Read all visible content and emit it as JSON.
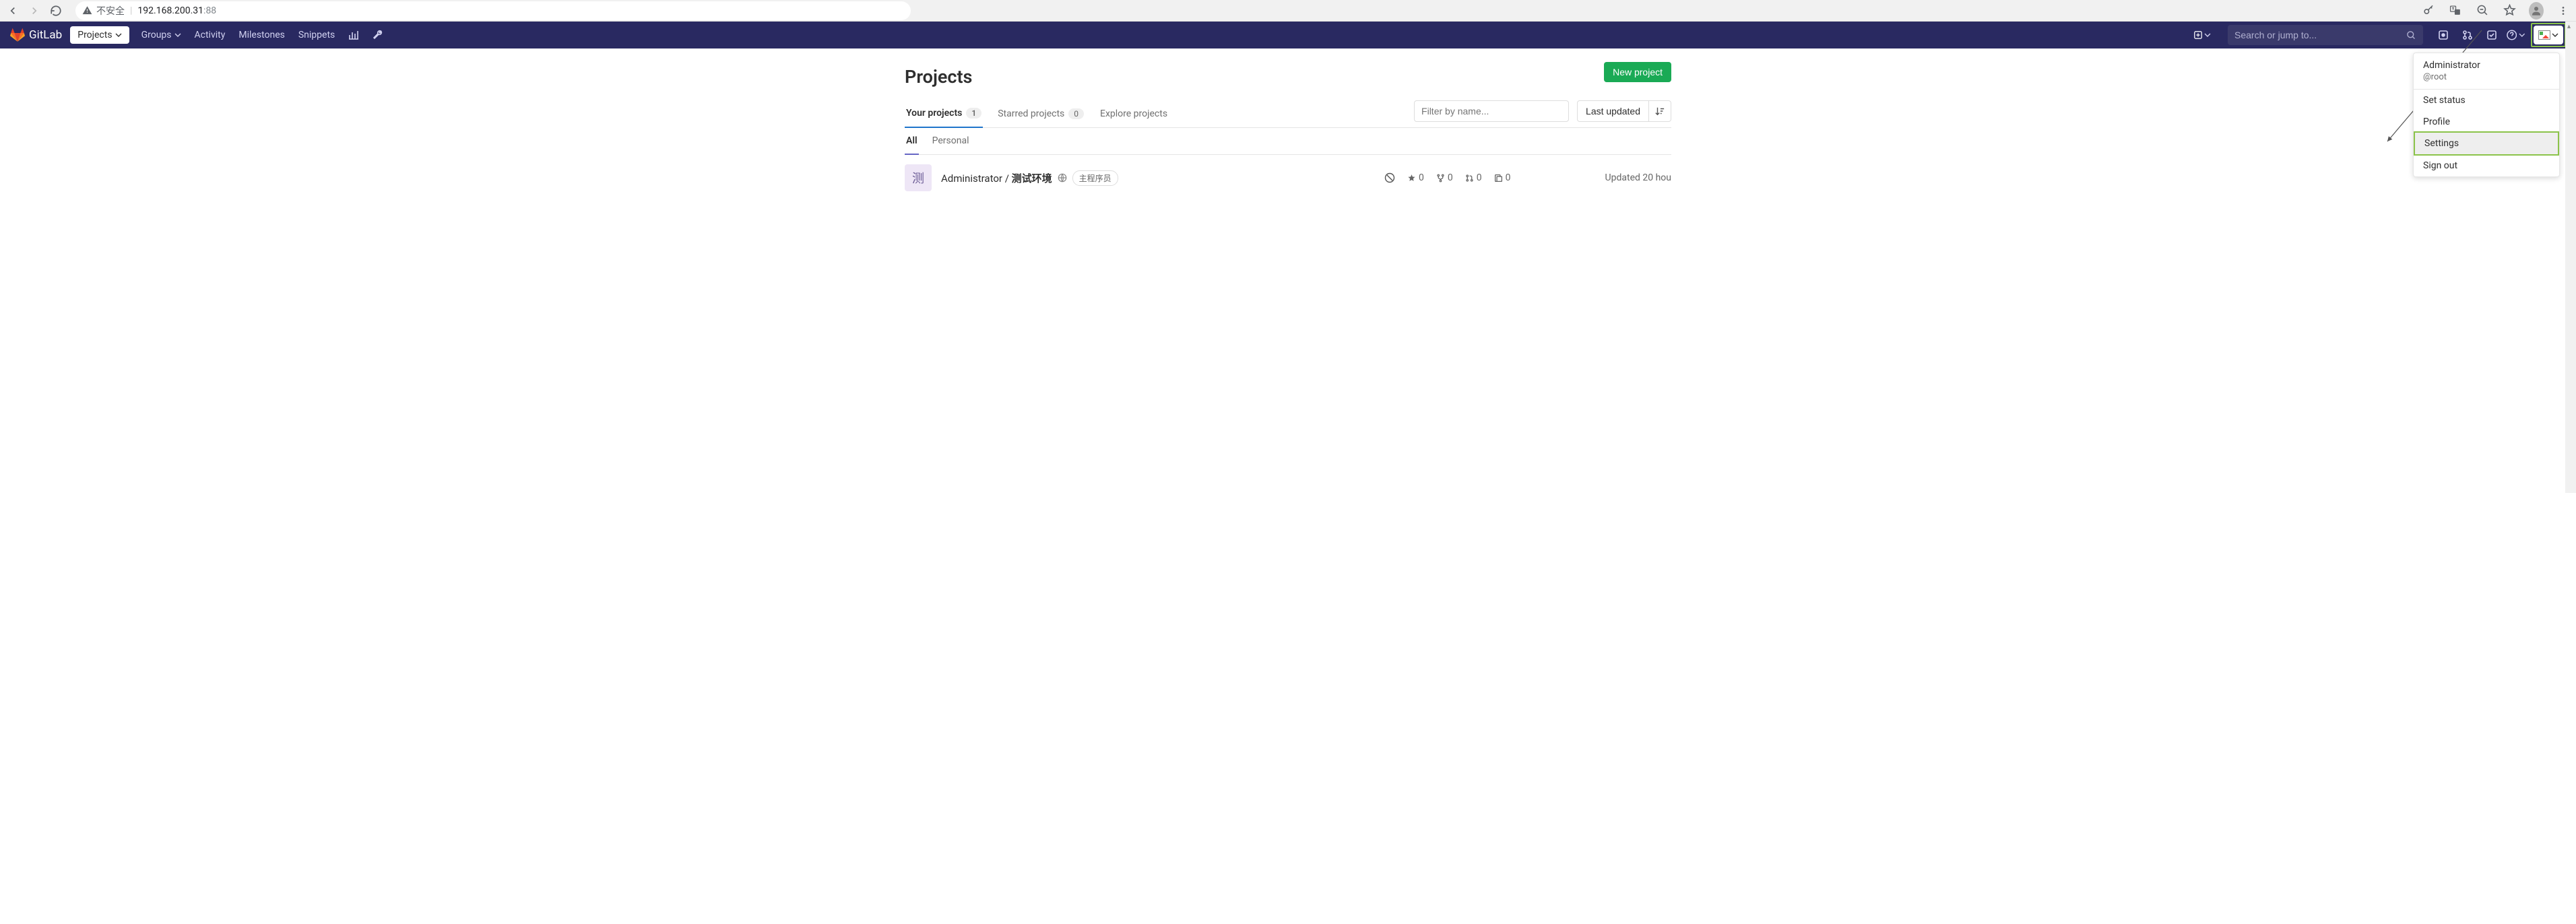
{
  "browser": {
    "insecure_label": "不安全",
    "url_host": "192.168.200.31",
    "url_port": ":88"
  },
  "header": {
    "brand": "GitLab",
    "nav": {
      "projects": "Projects",
      "groups": "Groups",
      "activity": "Activity",
      "milestones": "Milestones",
      "snippets": "Snippets"
    },
    "search_placeholder": "Search or jump to..."
  },
  "user_menu": {
    "name": "Administrator",
    "handle": "@root",
    "set_status": "Set status",
    "profile": "Profile",
    "settings": "Settings",
    "sign_out": "Sign out"
  },
  "page": {
    "title": "Projects",
    "new_project": "New project"
  },
  "tabs": {
    "your_projects": "Your projects",
    "your_count": "1",
    "starred": "Starred projects",
    "starred_count": "0",
    "explore": "Explore projects",
    "filter_placeholder": "Filter by name...",
    "sort": "Last updated"
  },
  "subtabs": {
    "all": "All",
    "personal": "Personal"
  },
  "project": {
    "avatar_letter": "测",
    "owner": "Administrator",
    "separator": " / ",
    "name": "测试环境",
    "role": "主程序员",
    "stars": "0",
    "forks": "0",
    "mrs": "0",
    "issues": "0",
    "updated": "Updated 20 hou"
  }
}
